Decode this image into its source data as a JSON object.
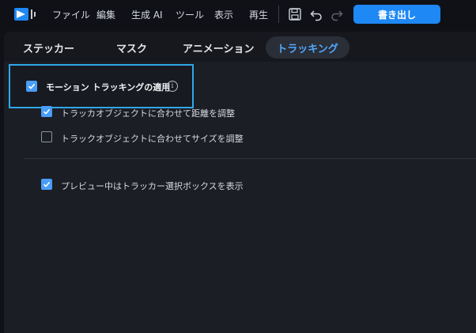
{
  "menubar": {
    "items": [
      "ファイル",
      "編集",
      "生成 AI",
      "ツール",
      "表示",
      "再生"
    ],
    "export_label": "書き出し"
  },
  "tabs": [
    {
      "label": "ステッカー",
      "active": false
    },
    {
      "label": "マスク",
      "active": false
    },
    {
      "label": "アニメーション",
      "active": false
    },
    {
      "label": "トラッキング",
      "active": true
    }
  ],
  "tracking": {
    "apply_label": "モーション トラッキングの適用",
    "apply_checked": true,
    "info_glyph": "i",
    "options": [
      {
        "label": "トラッカオブジェクトに合わせて距離を調整",
        "checked": true
      },
      {
        "label": "トラックオブジェクトに合わせてサイズを調整",
        "checked": false
      }
    ],
    "preview_label": "プレビュー中はトラッカー選択ボックスを表示",
    "preview_checked": true
  },
  "colors": {
    "accent": "#1e88f5",
    "active_tab_text": "#52a8ff",
    "highlight_border": "#2fa7ea",
    "checkbox": "#4a9df8"
  }
}
